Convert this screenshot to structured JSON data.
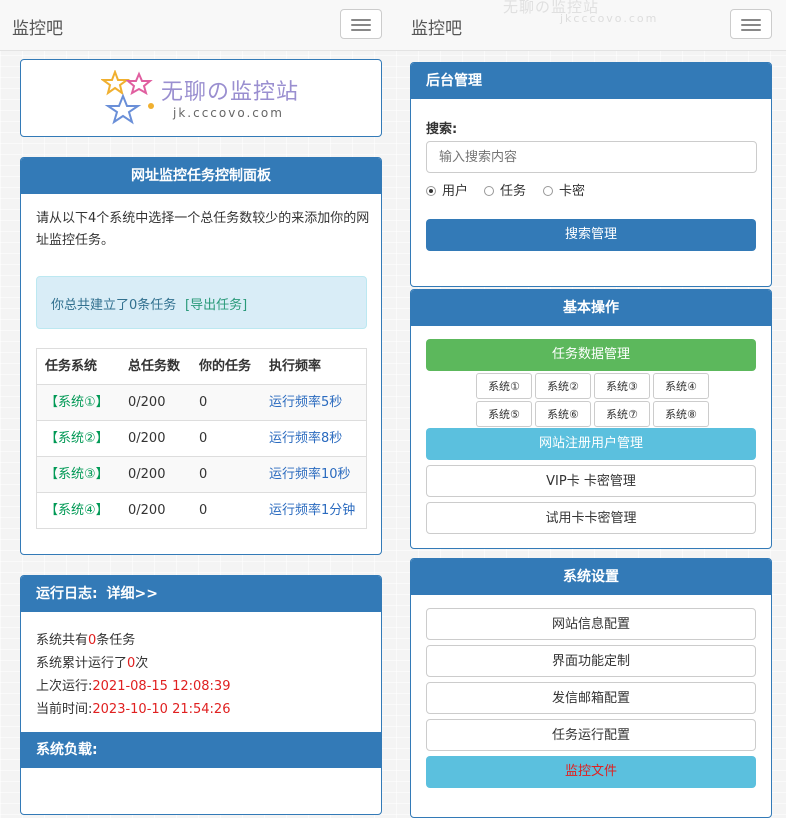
{
  "left_nav": {
    "brand": "监控吧"
  },
  "right_nav": {
    "brand": "监控吧"
  },
  "watermark": {
    "main": "无聊の监控站",
    "sub": "jkcccovo.com"
  },
  "logo": {
    "title": "无聊の监控站",
    "domain": "jk.cccovo.com"
  },
  "control_panel": {
    "title": "网址监控任务控制面板",
    "intro": "请从以下4个系统中选择一个总任务数较少的来添加你的网址监控任务。",
    "notice_prefix": "你总共建立了0条任务",
    "export_link": "[导出任务]",
    "table": {
      "headers": [
        "任务系统",
        "总任务数",
        "你的任务",
        "执行频率"
      ],
      "rows": [
        {
          "system": "【系统①】",
          "total": "0/200",
          "mine": "0",
          "freq": "运行频率5秒"
        },
        {
          "system": "【系统②】",
          "total": "0/200",
          "mine": "0",
          "freq": "运行频率8秒"
        },
        {
          "system": "【系统③】",
          "total": "0/200",
          "mine": "0",
          "freq": "运行频率10秒"
        },
        {
          "system": "【系统④】",
          "total": "0/200",
          "mine": "0",
          "freq": "运行频率1分钟"
        }
      ]
    }
  },
  "log_panel": {
    "title": "运行日志:",
    "detail_link": "详细>>",
    "line1_a": "系统共有",
    "line1_b": "0",
    "line1_c": "条任务",
    "line2_a": "系统累计运行了",
    "line2_b": "0",
    "line2_c": "次",
    "line3_a": "上次运行:",
    "line3_b": "2021-08-15 12:08:39",
    "line4_a": "当前时间:",
    "line4_b": "2023-10-10 21:54:26"
  },
  "load_panel": {
    "title": "系统负载:"
  },
  "admin_panel": {
    "title": "后台管理",
    "search_label": "搜索:",
    "search_placeholder": "输入搜索内容",
    "options": [
      "用户",
      "任务",
      "卡密"
    ],
    "search_button": "搜索管理"
  },
  "basic_panel": {
    "title": "基本操作",
    "task_data_button": "任务数据管理",
    "systems": [
      "系统①",
      "系统②",
      "系统③",
      "系统④",
      "系统⑤",
      "系统⑥",
      "系统⑦",
      "系统⑧"
    ],
    "user_manage_button": "网站注册用户管理",
    "vip_button": "VIP卡 卡密管理",
    "trial_button": "试用卡卡密管理"
  },
  "settings_panel": {
    "title": "系统设置",
    "buttons": [
      "网站信息配置",
      "界面功能定制",
      "发信邮箱配置",
      "任务运行配置"
    ],
    "monitor_file": "监控文件"
  },
  "colors": {
    "primary": "#337ab7",
    "success": "#5cb85c",
    "info": "#5bc0de",
    "danger": "#e02020",
    "link_green": "#009955"
  }
}
